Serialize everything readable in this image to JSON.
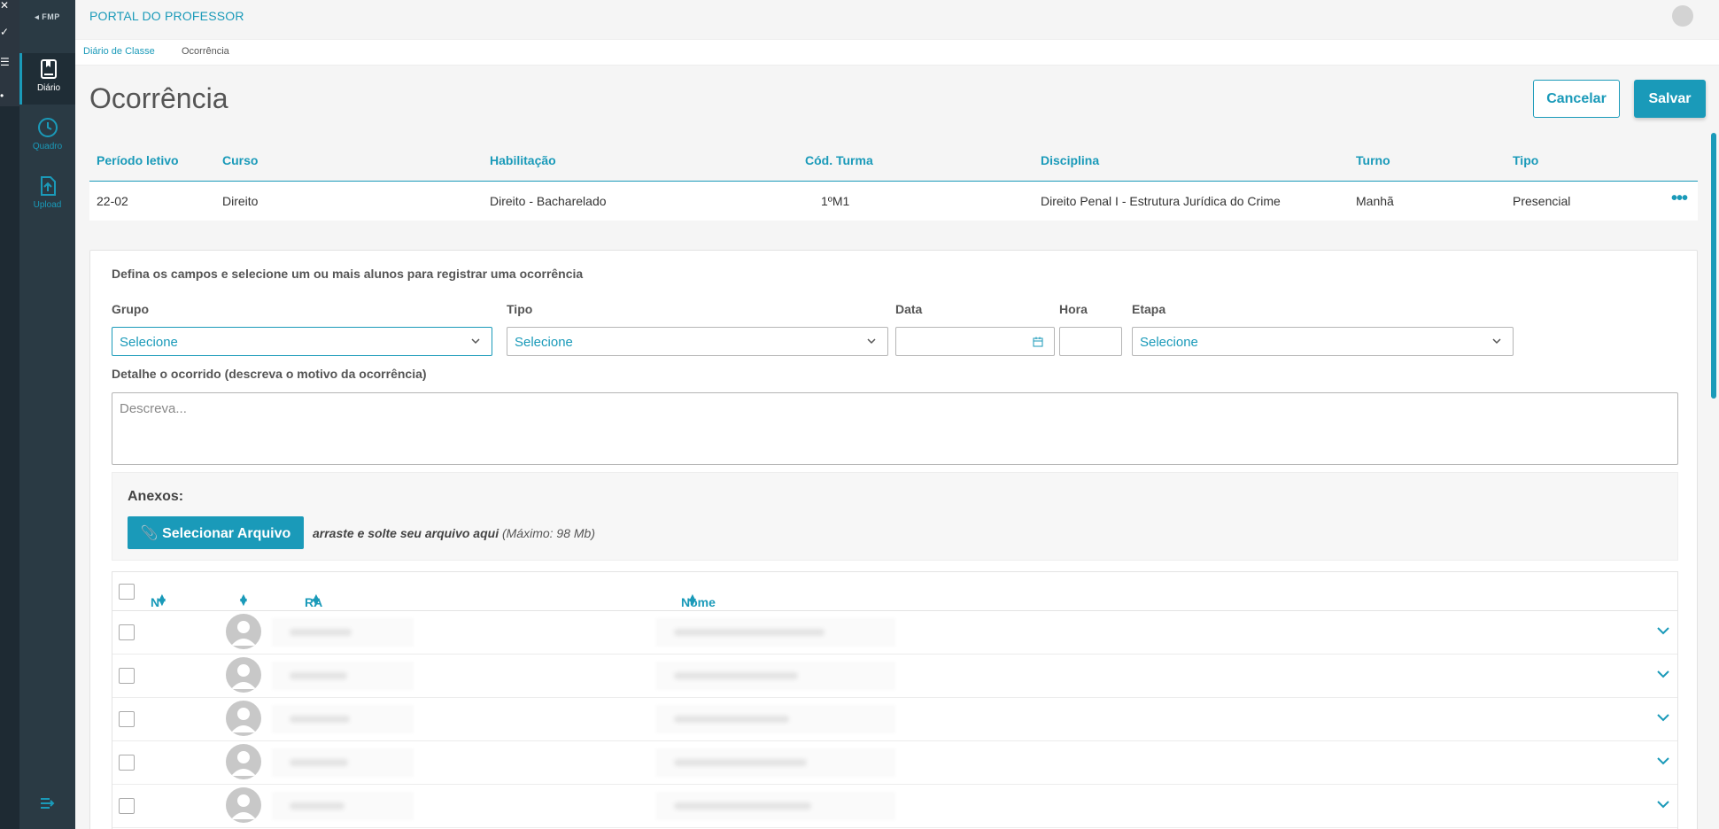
{
  "app": {
    "title": "PORTAL DO PROFESSOR",
    "logo": "FMP",
    "accent_color": "#1a9ab9"
  },
  "sidebar": {
    "items": [
      {
        "label": "Diário",
        "icon": "book-icon",
        "active": true
      },
      {
        "label": "Quadro",
        "icon": "clock-icon",
        "active": false
      },
      {
        "label": "Upload",
        "icon": "upload-icon",
        "active": false
      }
    ]
  },
  "breadcrumb": [
    "Diário de Classe",
    "Ocorrência"
  ],
  "page": {
    "title": "Ocorrência",
    "cancel_label": "Cancelar",
    "save_label": "Salvar"
  },
  "info_table": {
    "headers": [
      "Período letivo",
      "Curso",
      "Habilitação",
      "Cód. Turma",
      "Disciplina",
      "Turno",
      "Tipo"
    ],
    "row": [
      "22-02",
      "Direito",
      "Direito - Bacharelado",
      "1ºM1",
      "Direito Penal I - Estrutura Jurídica do Crime",
      "Manhã",
      "Presencial"
    ],
    "more_label": "•••"
  },
  "form": {
    "instructions": "Defina os campos e selecione um ou mais alunos para registrar uma ocorrência",
    "grupo": {
      "label": "Grupo",
      "value": "Selecione"
    },
    "tipo": {
      "label": "Tipo",
      "value": "Selecione"
    },
    "data": {
      "label": "Data",
      "value": ""
    },
    "hora": {
      "label": "Hora",
      "value": ""
    },
    "etapa": {
      "label": "Etapa",
      "value": "Selecione"
    },
    "detalhe": {
      "label": "Detalhe o ocorrido (descreva o motivo da ocorrência)",
      "placeholder": "Descreva..."
    }
  },
  "anexos": {
    "title": "Anexos:",
    "button_label": "Selecionar Arquivo",
    "drop_text": "arraste e solte seu arquivo aqui",
    "limit_text": "(Máximo: 98 Mb)"
  },
  "students": {
    "headers": {
      "numero": "Nº",
      "ra": "RA",
      "nome": "Nome"
    },
    "rows": [
      {},
      {},
      {},
      {},
      {}
    ]
  }
}
